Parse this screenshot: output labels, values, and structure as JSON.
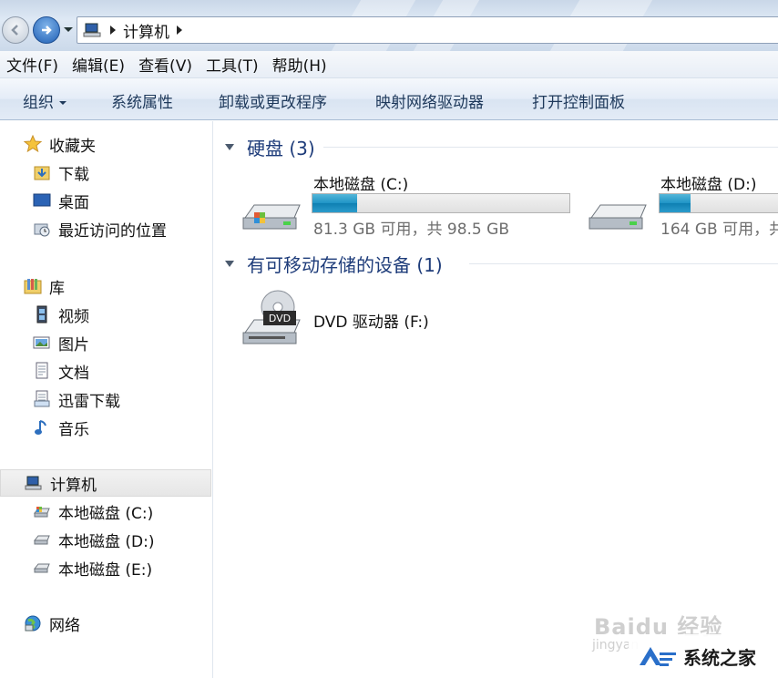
{
  "address_bar": {
    "crumbs": [
      "计算机"
    ]
  },
  "menu": [
    "文件(F)",
    "编辑(E)",
    "查看(V)",
    "工具(T)",
    "帮助(H)"
  ],
  "commands": {
    "organize": "组织",
    "system_properties": "系统属性",
    "uninstall": "卸载或更改程序",
    "map_drive": "映射网络驱动器",
    "control_panel": "打开控制面板"
  },
  "nav": {
    "favorites": "收藏夹",
    "favorites_items": [
      "下载",
      "桌面",
      "最近访问的位置"
    ],
    "libraries": "库",
    "library_items": [
      "视频",
      "图片",
      "文档",
      "迅雷下载",
      "音乐"
    ],
    "computer": "计算机",
    "computer_items": [
      "本地磁盘 (C:)",
      "本地磁盘 (D:)",
      "本地磁盘 (E:)"
    ],
    "network": "网络"
  },
  "hard_disks": {
    "header": "硬盘 (3)",
    "drives": [
      {
        "name": "本地磁盘 (C:)",
        "info": "81.3 GB 可用，共 98.5 GB",
        "used_fraction": 0.174
      },
      {
        "name": "本地磁盘 (D:)",
        "info": "164 GB 可用，共",
        "used_fraction": 0.3
      }
    ]
  },
  "removable": {
    "header": "有可移动存储的设备 (1)",
    "devices": [
      {
        "name": "DVD 驱动器 (F:)",
        "icon_text": "DVD"
      }
    ]
  },
  "watermark": {
    "baidu": "Baidu 经验",
    "jingyan": "jingyan",
    "site": "系统之家"
  }
}
